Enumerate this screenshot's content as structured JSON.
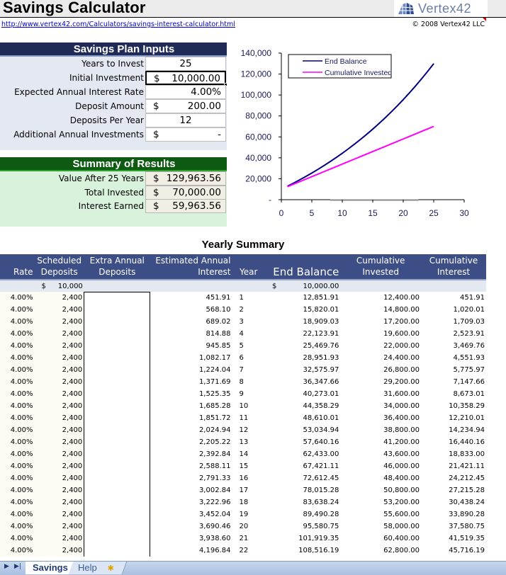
{
  "header": {
    "title": "Savings Calculator",
    "logo_text": "Vertex42",
    "url": "http://www.vertex42.com/Calculators/savings-interest-calculator.html",
    "copyright": "© 2008 Vertex42 LLC"
  },
  "inputs": {
    "title": "Savings Plan Inputs",
    "rows": [
      {
        "label": "Years to Invest",
        "currency": "",
        "value": "25",
        "align": "center"
      },
      {
        "label": "Initial Investment",
        "currency": "$",
        "value": "10,000.00",
        "align": "right",
        "selected": true
      },
      {
        "label": "Expected Annual Interest Rate",
        "currency": "",
        "value": "4.00%",
        "align": "right"
      },
      {
        "label": "Deposit Amount",
        "currency": "$",
        "value": "200.00",
        "align": "right"
      },
      {
        "label": "Deposits Per Year",
        "currency": "",
        "value": "12",
        "align": "center"
      },
      {
        "label": "Additional Annual Investments",
        "currency": "$",
        "value": "-",
        "align": "right"
      }
    ]
  },
  "results": {
    "title": "Summary of Results",
    "rows": [
      {
        "label": "Value After 25 Years",
        "currency": "$",
        "value": "129,963.56"
      },
      {
        "label": "Total Invested",
        "currency": "$",
        "value": "70,000.00"
      },
      {
        "label": "Interest Earned",
        "currency": "$",
        "value": "59,963.56"
      }
    ]
  },
  "chart_data": {
    "type": "line",
    "title": "",
    "xlabel": "",
    "ylabel": "",
    "xlim": [
      0,
      30
    ],
    "ylim": [
      0,
      140000
    ],
    "x_ticks": [
      "0",
      "5",
      "10",
      "15",
      "20",
      "25",
      "30"
    ],
    "y_ticks": [
      "-",
      "20,000",
      "40,000",
      "60,000",
      "80,000",
      "100,000",
      "120,000",
      "140,000"
    ],
    "grid": false,
    "legend_position": "top-left",
    "x": [
      1,
      2,
      3,
      4,
      5,
      6,
      7,
      8,
      9,
      10,
      11,
      12,
      13,
      14,
      15,
      16,
      17,
      18,
      19,
      20,
      21,
      22,
      23,
      24,
      25
    ],
    "series": [
      {
        "name": "End Balance",
        "color": "#000080",
        "values": [
          12851.91,
          15820.01,
          18909.03,
          22123.91,
          25469.76,
          28951.93,
          32575.97,
          36347.66,
          40273.01,
          44358.29,
          48610.01,
          53034.94,
          57640.16,
          62433.0,
          67421.11,
          72612.45,
          78015.28,
          83638.24,
          89490.28,
          95580.75,
          101919.35,
          108516.19,
          115381.0,
          122526.0,
          129963.56
        ]
      },
      {
        "name": "Cumulative Invested",
        "color": "#ff00ff",
        "values": [
          12400,
          14800,
          17200,
          19600,
          22000,
          24400,
          26800,
          29200,
          31600,
          34000,
          36400,
          38800,
          41200,
          43600,
          46000,
          48400,
          50800,
          53200,
          55600,
          58000,
          60400,
          62800,
          65200,
          67600,
          70000
        ]
      }
    ]
  },
  "yearly_summary": {
    "title": "Yearly Summary",
    "columns": [
      {
        "label_line1": "",
        "label_line2": "Rate"
      },
      {
        "label_line1": "Scheduled",
        "label_line2": "Deposits"
      },
      {
        "label_line1": "Extra Annual",
        "label_line2": "Deposits"
      },
      {
        "label_line1": "Estimated Annual",
        "label_line2": "Interest"
      },
      {
        "label_line1": "",
        "label_line2": "Year"
      },
      {
        "label_line1": "",
        "label_line2": "End Balance"
      },
      {
        "label_line1": "Cumulative",
        "label_line2": "Invested"
      },
      {
        "label_line1": "Cumulative",
        "label_line2": "Interest"
      }
    ],
    "initial_row": {
      "deposit_currency": "$",
      "deposit": "10,000",
      "balance_currency": "$",
      "balance": "10,000.00"
    },
    "rows": [
      {
        "rate": "4.00%",
        "sched": "2,400",
        "extra": "",
        "interest": "451.91",
        "year": "1",
        "balance": "12,851.91",
        "cum_inv": "12,400.00",
        "cum_int": "451.91"
      },
      {
        "rate": "4.00%",
        "sched": "2,400",
        "extra": "",
        "interest": "568.10",
        "year": "2",
        "balance": "15,820.01",
        "cum_inv": "14,800.00",
        "cum_int": "1,020.01"
      },
      {
        "rate": "4.00%",
        "sched": "2,400",
        "extra": "",
        "interest": "689.02",
        "year": "3",
        "balance": "18,909.03",
        "cum_inv": "17,200.00",
        "cum_int": "1,709.03"
      },
      {
        "rate": "4.00%",
        "sched": "2,400",
        "extra": "",
        "interest": "814.88",
        "year": "4",
        "balance": "22,123.91",
        "cum_inv": "19,600.00",
        "cum_int": "2,523.91"
      },
      {
        "rate": "4.00%",
        "sched": "2,400",
        "extra": "",
        "interest": "945.85",
        "year": "5",
        "balance": "25,469.76",
        "cum_inv": "22,000.00",
        "cum_int": "3,469.76"
      },
      {
        "rate": "4.00%",
        "sched": "2,400",
        "extra": "",
        "interest": "1,082.17",
        "year": "6",
        "balance": "28,951.93",
        "cum_inv": "24,400.00",
        "cum_int": "4,551.93"
      },
      {
        "rate": "4.00%",
        "sched": "2,400",
        "extra": "",
        "interest": "1,224.04",
        "year": "7",
        "balance": "32,575.97",
        "cum_inv": "26,800.00",
        "cum_int": "5,775.97"
      },
      {
        "rate": "4.00%",
        "sched": "2,400",
        "extra": "",
        "interest": "1,371.69",
        "year": "8",
        "balance": "36,347.66",
        "cum_inv": "29,200.00",
        "cum_int": "7,147.66"
      },
      {
        "rate": "4.00%",
        "sched": "2,400",
        "extra": "",
        "interest": "1,525.35",
        "year": "9",
        "balance": "40,273.01",
        "cum_inv": "31,600.00",
        "cum_int": "8,673.01"
      },
      {
        "rate": "4.00%",
        "sched": "2,400",
        "extra": "",
        "interest": "1,685.28",
        "year": "10",
        "balance": "44,358.29",
        "cum_inv": "34,000.00",
        "cum_int": "10,358.29"
      },
      {
        "rate": "4.00%",
        "sched": "2,400",
        "extra": "",
        "interest": "1,851.72",
        "year": "11",
        "balance": "48,610.01",
        "cum_inv": "36,400.00",
        "cum_int": "12,210.01"
      },
      {
        "rate": "4.00%",
        "sched": "2,400",
        "extra": "",
        "interest": "2,024.94",
        "year": "12",
        "balance": "53,034.94",
        "cum_inv": "38,800.00",
        "cum_int": "14,234.94"
      },
      {
        "rate": "4.00%",
        "sched": "2,400",
        "extra": "",
        "interest": "2,205.22",
        "year": "13",
        "balance": "57,640.16",
        "cum_inv": "41,200.00",
        "cum_int": "16,440.16"
      },
      {
        "rate": "4.00%",
        "sched": "2,400",
        "extra": "",
        "interest": "2,392.84",
        "year": "14",
        "balance": "62,433.00",
        "cum_inv": "43,600.00",
        "cum_int": "18,833.00"
      },
      {
        "rate": "4.00%",
        "sched": "2,400",
        "extra": "",
        "interest": "2,588.11",
        "year": "15",
        "balance": "67,421.11",
        "cum_inv": "46,000.00",
        "cum_int": "21,421.11"
      },
      {
        "rate": "4.00%",
        "sched": "2,400",
        "extra": "",
        "interest": "2,791.33",
        "year": "16",
        "balance": "72,612.45",
        "cum_inv": "48,400.00",
        "cum_int": "24,212.45"
      },
      {
        "rate": "4.00%",
        "sched": "2,400",
        "extra": "",
        "interest": "3,002.84",
        "year": "17",
        "balance": "78,015.28",
        "cum_inv": "50,800.00",
        "cum_int": "27,215.28"
      },
      {
        "rate": "4.00%",
        "sched": "2,400",
        "extra": "",
        "interest": "3,222.96",
        "year": "18",
        "balance": "83,638.24",
        "cum_inv": "53,200.00",
        "cum_int": "30,438.24"
      },
      {
        "rate": "4.00%",
        "sched": "2,400",
        "extra": "",
        "interest": "3,452.04",
        "year": "19",
        "balance": "89,490.28",
        "cum_inv": "55,600.00",
        "cum_int": "33,890.28"
      },
      {
        "rate": "4.00%",
        "sched": "2,400",
        "extra": "",
        "interest": "3,690.46",
        "year": "20",
        "balance": "95,580.75",
        "cum_inv": "58,000.00",
        "cum_int": "37,580.75"
      },
      {
        "rate": "4.00%",
        "sched": "2,400",
        "extra": "",
        "interest": "3,938.60",
        "year": "21",
        "balance": "101,919.35",
        "cum_inv": "60,400.00",
        "cum_int": "41,519.35"
      },
      {
        "rate": "4.00%",
        "sched": "2,400",
        "extra": "",
        "interest": "4,196.84",
        "year": "22",
        "balance": "108,516.19",
        "cum_inv": "62,800.00",
        "cum_int": "45,716.19"
      }
    ]
  },
  "sheet_tabs": {
    "nav_next": "▶",
    "nav_last": "▶|",
    "tabs": [
      "Savings",
      "Help"
    ],
    "active": "Savings",
    "new_sheet_icon": "✱"
  },
  "colors": {
    "inputs_header": "#1f2b56",
    "results_header": "#0f5a12",
    "table_header": "#3c4e85",
    "end_balance": "#000080",
    "cumulative_invested": "#ff00ff"
  }
}
